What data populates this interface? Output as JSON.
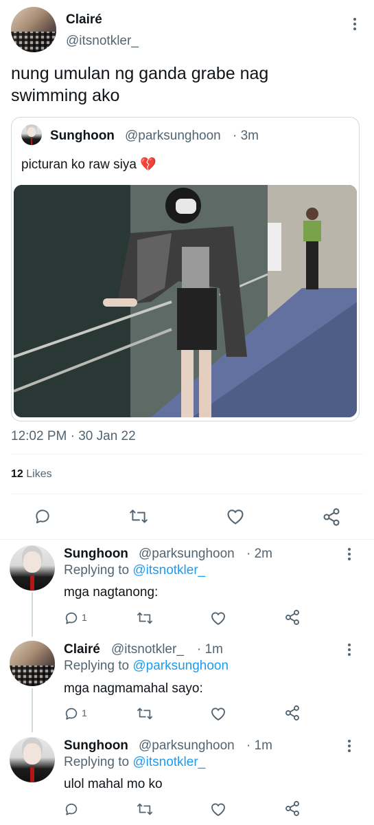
{
  "main_tweet": {
    "author_name": "Clairé",
    "author_handle": "@itsnotkler_",
    "text": "nung umulan ng ganda grabe nag swimming ako",
    "timestamp": "12:02 PM · 30 Jan 22",
    "likes_count": "12",
    "likes_label": "Likes"
  },
  "quoted_tweet": {
    "author_name": "Sunghoon",
    "author_handle": "@parksunghoon",
    "time": "· 3m",
    "text": "picturan ko raw siya 💔"
  },
  "replies": [
    {
      "author_name": "Sunghoon",
      "author_handle": "@parksunghoon",
      "time": "· 2m",
      "replying_prefix": "Replying to",
      "replying_to": "@itsnotkler_",
      "text": "mga nagtanong:",
      "reply_count": "1"
    },
    {
      "author_name": "Clairé",
      "author_handle": "@itsnotkler_",
      "time": "· 1m",
      "replying_prefix": "Replying to",
      "replying_to": "@parksunghoon",
      "text": "mga nagmamahal sayo:",
      "reply_count": "1"
    },
    {
      "author_name": "Sunghoon",
      "author_handle": "@parksunghoon",
      "time": "· 1m",
      "replying_prefix": "Replying to",
      "replying_to": "@itsnotkler_",
      "text": "ulol mahal mo ko",
      "reply_count": ""
    }
  ],
  "icons": {
    "reply": "speech-bubble-icon",
    "retweet": "retweet-icon",
    "like": "heart-icon",
    "share": "share-icon",
    "more": "more-vertical-icon"
  },
  "colors": {
    "text": "#0f1419",
    "muted": "#536471",
    "link": "#1d9bf0",
    "divider": "#eff3f4"
  }
}
